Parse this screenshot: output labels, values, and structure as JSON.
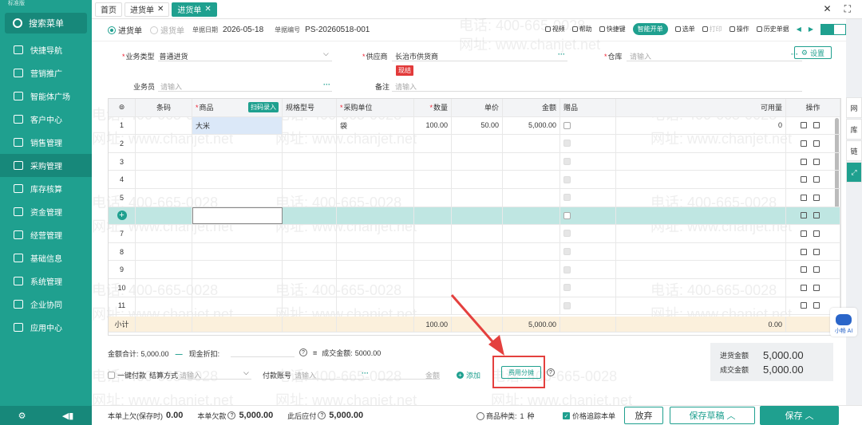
{
  "sidebar": {
    "brand": "标准版",
    "search_label": "搜索菜单",
    "items": [
      {
        "label": "快捷导航",
        "icon": "home-icon"
      },
      {
        "label": "营销推广",
        "icon": "gift-icon"
      },
      {
        "label": "智能体广场",
        "icon": "robot-icon"
      },
      {
        "label": "客户中心",
        "icon": "user-icon"
      },
      {
        "label": "销售管理",
        "icon": "cart-icon"
      },
      {
        "label": "采购管理",
        "icon": "truck-icon",
        "active": true
      },
      {
        "label": "库存核算",
        "icon": "warehouse-icon"
      },
      {
        "label": "资金管理",
        "icon": "money-icon"
      },
      {
        "label": "经营管理",
        "icon": "report-icon"
      },
      {
        "label": "基础信息",
        "icon": "info-icon"
      },
      {
        "label": "系统管理",
        "icon": "gear-icon"
      },
      {
        "label": "企业协同",
        "icon": "team-icon"
      },
      {
        "label": "应用中心",
        "icon": "app-icon"
      }
    ],
    "bottom_left_icon": "⚙",
    "bottom_right_icon": "◀▮"
  },
  "tabs": [
    {
      "label": "首页",
      "closable": false
    },
    {
      "label": "进货单",
      "closable": true
    },
    {
      "label": "进货单",
      "closable": true,
      "active": true
    }
  ],
  "window": {
    "close": "✕",
    "fullscreen": "⛶"
  },
  "toolbar": {
    "radio_purchase": "进货单",
    "radio_return": "退货单",
    "date_label": "单据日期",
    "date_value": "2026-05-18",
    "no_label": "单据编号",
    "no_value": "PS-20260518-001",
    "buttons": {
      "video": "视频",
      "help": "帮助",
      "shortcut": "快捷键",
      "smart": "智能开单",
      "select": "选单",
      "print": "打印",
      "operate": "操作",
      "history": "历史单据"
    }
  },
  "form": {
    "biz_type_label": "业务类型",
    "biz_type_value": "普通进货",
    "supplier_label": "供应商",
    "supplier_value": "长治市供货商",
    "supplier_badge": "现结",
    "warehouse_label": "仓库",
    "warehouse_placeholder": "请输入",
    "clerk_label": "业务员",
    "clerk_placeholder": "请输入",
    "note_label": "备注",
    "note_placeholder": "请输入",
    "settings_label": "设置",
    "dots": "···"
  },
  "grid": {
    "headers": {
      "col_icon": "⊚",
      "barcode": "条码",
      "product": "商品",
      "scan": "扫码录入",
      "spec": "规格型号",
      "unit": "采购单位",
      "qty": "数量",
      "price": "单价",
      "amount": "金额",
      "gift": "赠品",
      "available": "可用量",
      "ops": "操作"
    },
    "rows": [
      {
        "no": "1",
        "product": "大米",
        "unit": "袋",
        "qty": "100.00",
        "price": "50.00",
        "amount": "5,000.00",
        "available": "0"
      },
      {
        "no": "2"
      },
      {
        "no": "3"
      },
      {
        "no": "4"
      },
      {
        "no": "5"
      },
      {
        "no": "+",
        "highlight": true
      },
      {
        "no": "7"
      },
      {
        "no": "8"
      },
      {
        "no": "9"
      },
      {
        "no": "10"
      },
      {
        "no": "11"
      }
    ],
    "subtotal": {
      "label": "小计",
      "qty": "100.00",
      "amount": "5,000.00",
      "available": "0.00"
    }
  },
  "summary": {
    "total_label": "金额合计:",
    "total_value": "5,000.00",
    "cash_discount_label": "现金折扣:",
    "deal_label": "成交金额:",
    "deal_value": "5000.00",
    "onekey_pay": "一键付款",
    "settle_label": "结算方式",
    "settle_placeholder": "请输入",
    "account_label": "付款账号",
    "account_placeholder": "请输入",
    "amount_placeholder": "金额",
    "add_label": "添加",
    "fee_button": "费用分摊",
    "purchase_amount_label": "进货金额",
    "purchase_amount_value": "5,000.00",
    "deal_amount_label": "成交金额",
    "deal_amount_value": "5,000.00"
  },
  "bottom": {
    "prev_owe_label": "本单上欠(保存时)",
    "prev_owe_value": "0.00",
    "this_owe_label": "本单欠款",
    "this_owe_value": "5,000.00",
    "after_pay_label": "此后应付",
    "after_pay_value": "5,000.00",
    "kinds_label": "商品种类:",
    "kinds_value": "1",
    "kinds_unit": "种",
    "price_trace": "价格追踪本单",
    "giveup": "放弃",
    "save_draft": "保存草稿",
    "save": "保存"
  },
  "rightrail": [
    "网",
    "库",
    "链",
    "⤢"
  ],
  "assistant_label": "小畅 AI",
  "watermark": {
    "phone": "电话: 400-665-0028",
    "site": "网址: www.chanjet.net"
  },
  "colors": {
    "brand": "#1fa08f",
    "danger": "#e4403e",
    "highlight_row": "#bfe6e2",
    "subtotal": "#fbf0dc"
  }
}
